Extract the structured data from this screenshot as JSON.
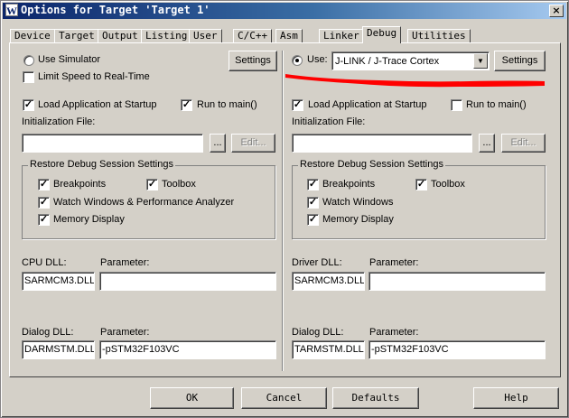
{
  "window": {
    "title": "Options for Target 'Target 1'",
    "icon": "W",
    "close_glyph": "×"
  },
  "tabs": [
    "Device",
    "Target",
    "Output",
    "Listing",
    "User",
    "C/C++",
    "Asm",
    "Linker",
    "Debug",
    "Utilities"
  ],
  "active_tab": "Debug",
  "left": {
    "use_simulator": "Use Simulator",
    "limit_speed": "Limit Speed to Real-Time",
    "settings": "Settings",
    "load_app": "Load Application at Startup",
    "run_to_main": "Run to main()",
    "init_file_label": "Initialization File:",
    "init_file_value": "",
    "browse": "...",
    "edit": "Edit...",
    "restore_group": "Restore Debug Session Settings",
    "breakpoints": "Breakpoints",
    "toolbox": "Toolbox",
    "watch": "Watch Windows & Performance Analyzer",
    "memory": "Memory Display",
    "cpu_dll_label": "CPU DLL:",
    "cpu_dll_value": "SARMCM3.DLL",
    "cpu_param_label": "Parameter:",
    "cpu_param_value": "",
    "dialog_dll_label": "Dialog DLL:",
    "dialog_dll_value": "DARMSTM.DLL",
    "dialog_param_label": "Parameter:",
    "dialog_param_value": "-pSTM32F103VC"
  },
  "right": {
    "use": "Use:",
    "driver": "J-LINK / J-Trace Cortex",
    "settings": "Settings",
    "load_app": "Load Application at Startup",
    "run_to_main": "Run to main()",
    "init_file_label": "Initialization File:",
    "init_file_value": "",
    "browse": "...",
    "edit": "Edit...",
    "restore_group": "Restore Debug Session Settings",
    "breakpoints": "Breakpoints",
    "toolbox": "Toolbox",
    "watch": "Watch Windows",
    "memory": "Memory Display",
    "driver_dll_label": "Driver DLL:",
    "driver_dll_value": "SARMCM3.DLL",
    "driver_param_label": "Parameter:",
    "driver_param_value": "",
    "dialog_dll_label": "Dialog DLL:",
    "dialog_dll_value": "TARMSTM.DLL",
    "dialog_param_label": "Parameter:",
    "dialog_param_value": "-pSTM32F103VC"
  },
  "buttons": {
    "ok": "OK",
    "cancel": "Cancel",
    "defaults": "Defaults",
    "help": "Help"
  },
  "state": {
    "simulator_selected": false,
    "use_driver_selected": true,
    "limit_speed_checked": false,
    "left_load_app_checked": true,
    "left_run_to_main_checked": true,
    "left_breakpoints_checked": true,
    "left_toolbox_checked": true,
    "left_watch_checked": true,
    "left_memory_checked": true,
    "right_load_app_checked": true,
    "right_run_to_main_checked": false,
    "right_breakpoints_checked": true,
    "right_toolbox_checked": true,
    "right_watch_checked": true,
    "right_memory_checked": true
  },
  "check_glyph": "✓",
  "dropdown_glyph": "▼",
  "annotation_color": "#ff0000",
  "title_gradient": [
    "#0a246a",
    "#a6caf0"
  ]
}
